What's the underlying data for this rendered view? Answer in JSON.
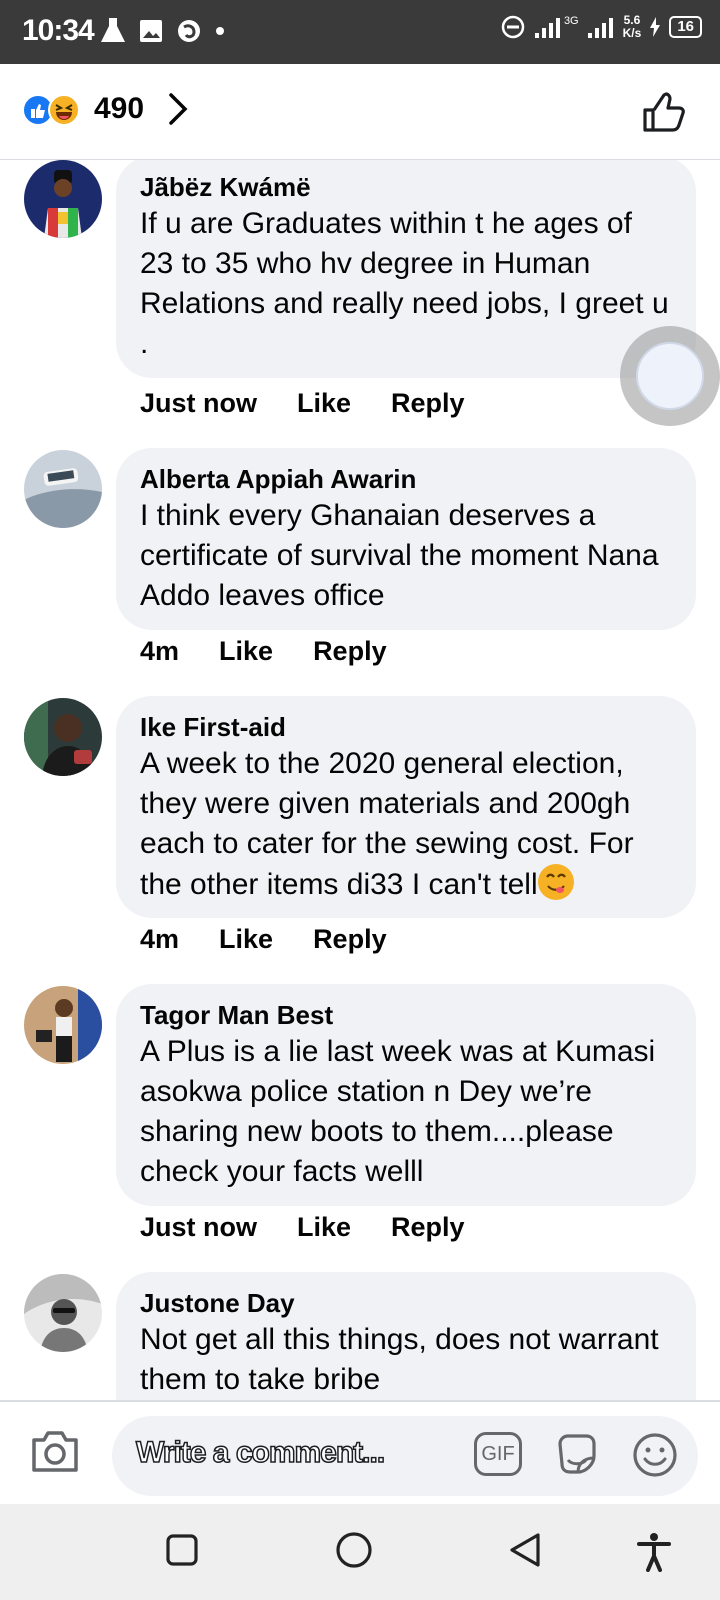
{
  "status_bar": {
    "time": "10:34",
    "network": "3G",
    "speed_value": "5.6",
    "speed_unit": "K/s",
    "battery": "16"
  },
  "reactions": {
    "count": "490",
    "icons": [
      "like-icon",
      "haha-icon"
    ]
  },
  "comments": [
    {
      "author": "Jãbëz Kwámë",
      "text": "If u are Graduates within t he ages of 23 to 35 who hv degree in Human Relations and really need jobs, I greet u .",
      "time": "Just now",
      "like_label": "Like",
      "reply_label": "Reply"
    },
    {
      "author": "Alberta Appiah Awarin",
      "text": "I think every Ghanaian deserves a certificate of survival the moment Nana Addo leaves office",
      "time": "4m",
      "like_label": "Like",
      "reply_label": "Reply"
    },
    {
      "author": "Ike First-aid",
      "text": "A week to the 2020 general election, they were given materials and 200gh each to cater for the sewing cost. For the other items di33 I can't tell",
      "emoji": "savoring-food-emoji",
      "time": "4m",
      "like_label": "Like",
      "reply_label": "Reply"
    },
    {
      "author": "Tagor Man Best",
      "text": "A Plus is a lie last week was at Kumasi asokwa police station n Dey we’re sharing new boots to them....please check your facts welll",
      "time": "Just now",
      "like_label": "Like",
      "reply_label": "Reply"
    },
    {
      "author": "Justone Day",
      "text": "Not get all this things, does not warrant them to take bribe"
    }
  ],
  "composer": {
    "placeholder": "Write a comment...",
    "gif_label": "GIF"
  },
  "colors": {
    "status_bar": "#3a3a3a",
    "bubble": "#f0f2f5",
    "like_blue": "#1877f2",
    "text": "#050505",
    "icon_gray": "#65676b"
  }
}
